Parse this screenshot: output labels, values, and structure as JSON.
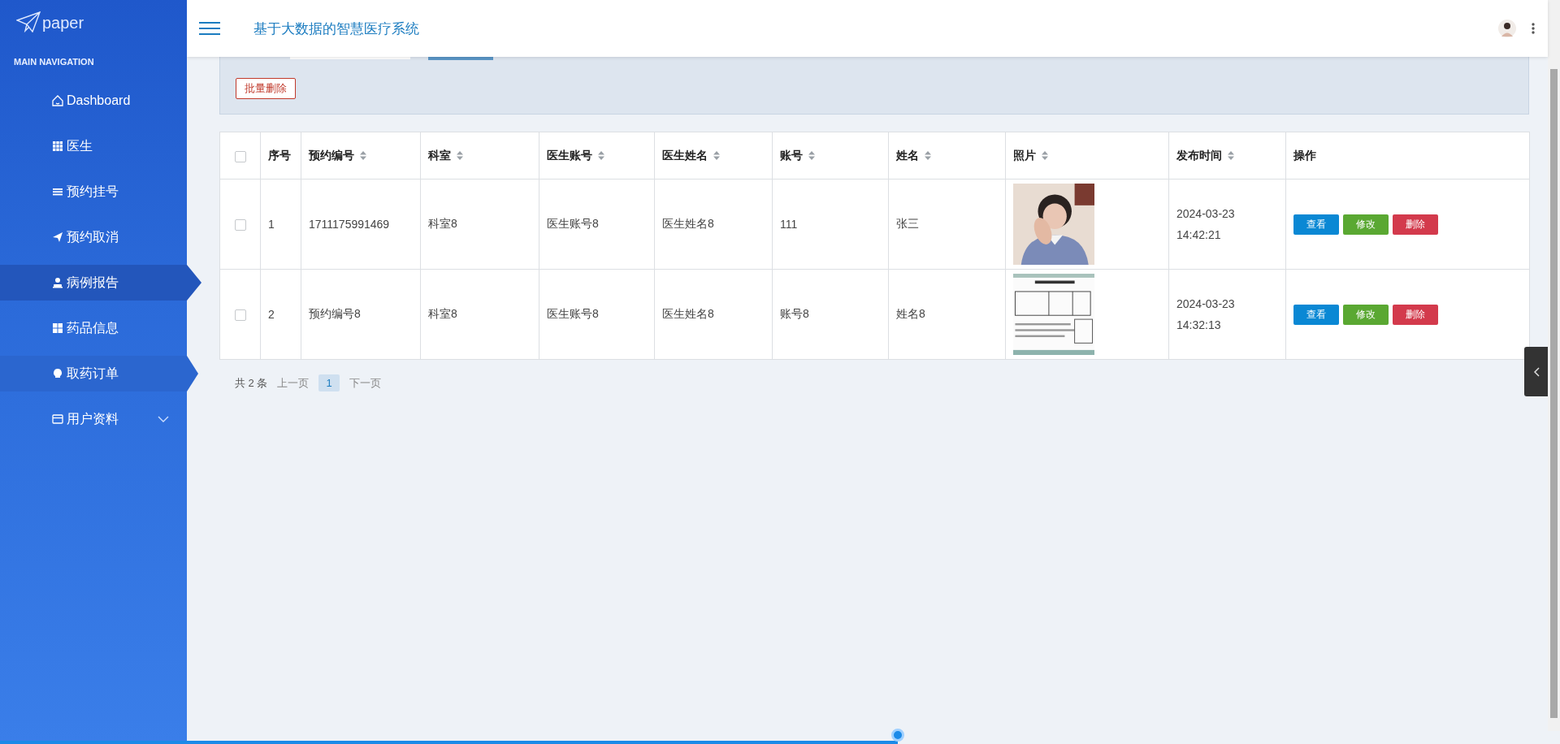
{
  "sidebar": {
    "logo": "paper",
    "section_title": "MAIN NAVIGATION",
    "items": [
      {
        "label": "Dashboard",
        "kind": "home",
        "selected": false,
        "hovered": false
      },
      {
        "label": "医生",
        "kind": "grid",
        "selected": false,
        "hovered": false
      },
      {
        "label": "预约挂号",
        "kind": "list",
        "selected": false,
        "hovered": false
      },
      {
        "label": "预约取消",
        "kind": "send",
        "selected": false,
        "hovered": false
      },
      {
        "label": "病例报告",
        "kind": "user",
        "selected": true,
        "hovered": false
      },
      {
        "label": "药品信息",
        "kind": "tiles",
        "selected": false,
        "hovered": false
      },
      {
        "label": "取药订单",
        "kind": "bulb",
        "selected": false,
        "hovered": true
      },
      {
        "label": "用户资料",
        "kind": "card",
        "selected": false,
        "hovered": false,
        "expanded": false
      }
    ]
  },
  "header": {
    "title": "基于大数据的智慧医疗系统"
  },
  "toolbar": {
    "batch_delete": "批量删除"
  },
  "table": {
    "select_all": {
      "checked": false
    },
    "columns": [
      {
        "label": "序号",
        "sortable": false
      },
      {
        "label": "预约编号",
        "sortable": true
      },
      {
        "label": "科室",
        "sortable": true
      },
      {
        "label": "医生账号",
        "sortable": true
      },
      {
        "label": "医生姓名",
        "sortable": true
      },
      {
        "label": "账号",
        "sortable": true
      },
      {
        "label": "姓名",
        "sortable": true
      },
      {
        "label": "照片",
        "sortable": true
      },
      {
        "label": "发布时间",
        "sortable": true
      },
      {
        "label": "操作",
        "sortable": false
      }
    ],
    "rows": [
      {
        "checked": false,
        "cells": [
          "1",
          "1711175991469",
          "科室8",
          "医生账号8",
          "医生姓名8",
          "111",
          "张三"
        ],
        "photo": {
          "kind": "picture"
        },
        "time": "2024-03-23 14:42:21",
        "actions": [
          "查看",
          "修改",
          "删除"
        ]
      },
      {
        "checked": false,
        "cells": [
          "2",
          "预约编号8",
          "科室8",
          "医生账号8",
          "医生姓名8",
          "账号8",
          "姓名8"
        ],
        "photo": {
          "kind": "picture"
        },
        "time": "2024-03-23 14:32:13",
        "actions": [
          "查看",
          "修改",
          "删除"
        ]
      }
    ]
  },
  "pagination": {
    "total": "共 2 条",
    "prev": "上一页",
    "pages": [
      {
        "label": "1",
        "selected": true
      }
    ],
    "next": "下一页"
  },
  "progress": {
    "level": 0.58
  }
}
